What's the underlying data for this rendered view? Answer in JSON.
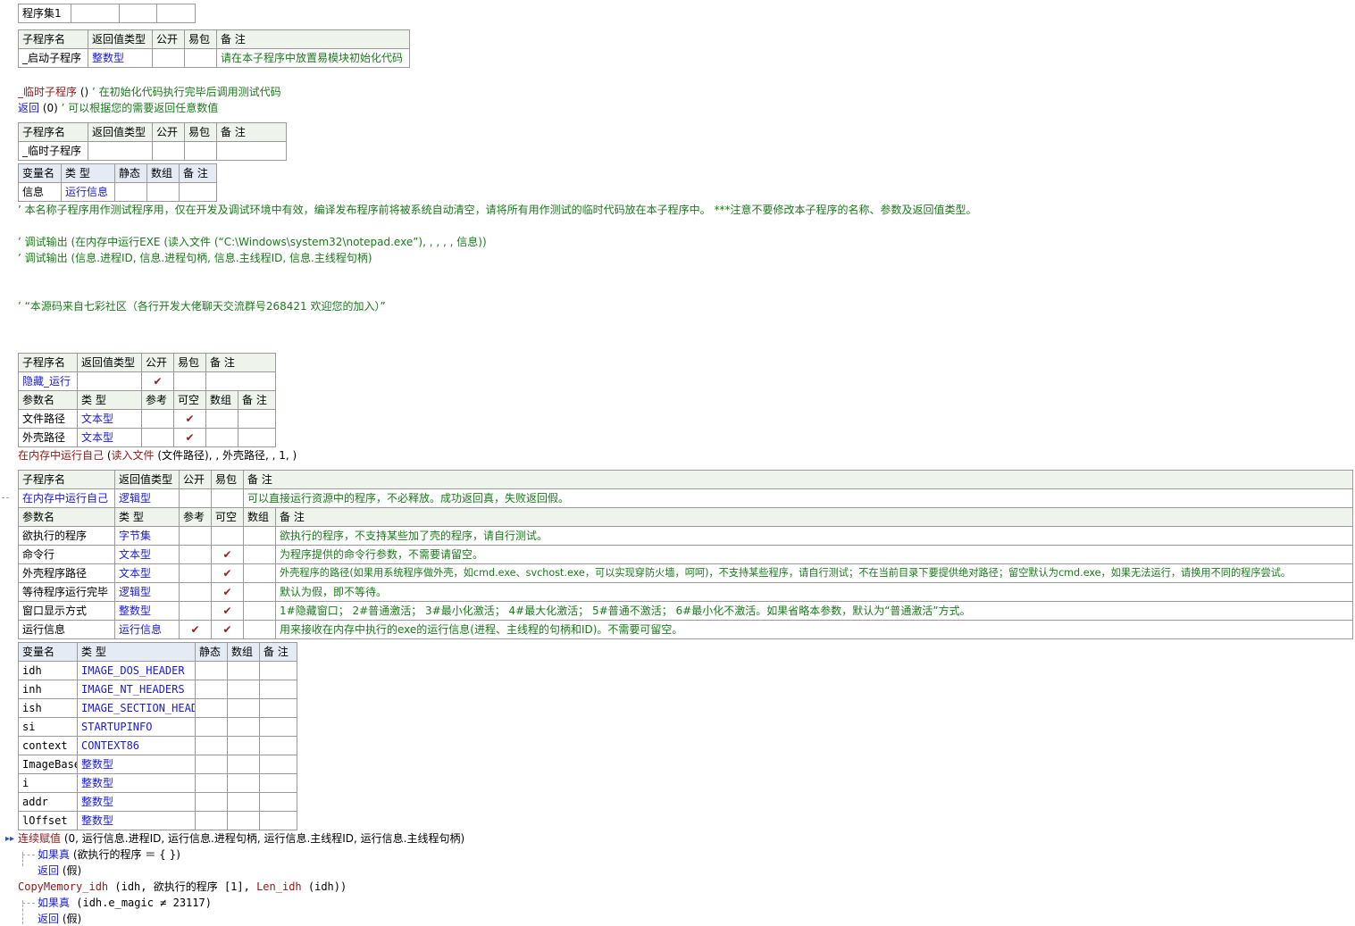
{
  "colors": {
    "keyword_blue": "#1a1ad8",
    "comment_green": "#1a7a1a",
    "call_darkred": "#8b1a1a",
    "check_red": "#9b1c1c",
    "header_bg": "#eef3ec"
  },
  "top_table": {
    "name": "程序集1"
  },
  "start_sub": {
    "headers": [
      "子程序名",
      "返回值类型",
      "公开",
      "易包",
      "备 注"
    ],
    "row": {
      "name": "_启动子程序",
      "type": "整数型",
      "note": "请在本子程序中放置易模块初始化代码"
    }
  },
  "code1": {
    "line1_call": "_临时子程序",
    "line1_args": " ()",
    "line1_comment": "’ 在初始化代码执行完毕后调用测试代码",
    "line2_kw": "返回",
    "line2_args": " (0)",
    "line2_comment": "’ 可以根据您的需要返回任意数值"
  },
  "temp_sub": {
    "headers": [
      "子程序名",
      "返回值类型",
      "公开",
      "易包",
      "备 注"
    ],
    "row": {
      "name": "_临时子程序"
    },
    "var_headers": [
      "变量名",
      "类 型",
      "静态",
      "数组",
      "备 注"
    ],
    "var_row": {
      "name": "信息",
      "type": "运行信息"
    }
  },
  "comments": {
    "c1": "’ 本名称子程序用作测试程序用，仅在开发及调试环境中有效，编译发布程序前将被系统自动清空，请将所有用作测试的临时代码放在本子程序中。 ***注意不要修改本子程序的名称、参数及返回值类型。",
    "c2": "’ 调试输出 (在内存中运行EXE (读入文件 (“C:\\Windows\\system32\\notepad.exe”), , , , , 信息))",
    "c3": "’ 调试输出 (信息.进程ID, 信息.进程句柄, 信息.主线程ID, 信息.主线程句柄)",
    "c4": "’ “本源码来自七彩社区（各行开发大佬聊天交流群号268421 欢迎您的加入）”"
  },
  "hide_sub": {
    "headers": [
      "子程序名",
      "返回值类型",
      "公开",
      "易包",
      "备 注"
    ],
    "row": {
      "name": "隐藏_运行",
      "check": "✔"
    },
    "param_headers": [
      "参数名",
      "类 型",
      "参考",
      "可空",
      "数组",
      "备 注"
    ],
    "params": [
      {
        "name": "文件路径",
        "type": "文本型",
        "check": "✔"
      },
      {
        "name": "外壳路径",
        "type": "文本型",
        "check": "✔"
      }
    ]
  },
  "code2": {
    "call": "在内存中运行自己",
    "mid": " (",
    "call2": "读入文件",
    "rest": " (文件路径), , 外壳路径, , 1, )"
  },
  "mem_sub": {
    "headers": [
      "子程序名",
      "返回值类型",
      "公开",
      "易包",
      "备 注"
    ],
    "row": {
      "name": "在内存中运行自己",
      "type": "逻辑型",
      "note": "可以直接运行资源中的程序，不必释放。成功返回真，失败返回假。"
    },
    "param_headers": [
      "参数名",
      "类 型",
      "参考",
      "可空",
      "数组",
      "备 注"
    ],
    "params": [
      {
        "name": "欲执行的程序",
        "type": "字节集",
        "ref": "",
        "opt": "",
        "note": "欲执行的程序，不支持某些加了壳的程序，请自行测试。"
      },
      {
        "name": "命令行",
        "type": "文本型",
        "ref": "",
        "opt": "✔",
        "note": "为程序提供的命令行参数，不需要请留空。"
      },
      {
        "name": "外壳程序路径",
        "type": "文本型",
        "ref": "",
        "opt": "✔",
        "note": "外壳程序的路径(如果用系统程序做外壳，如cmd.exe、svchost.exe，可以实现穿防火墙，呵呵)，不支持某些程序，请自行测试；不在当前目录下要提供绝对路径；留空默认为cmd.exe，如果无法运行，请换用不同的程序尝试。"
      },
      {
        "name": "等待程序运行完毕",
        "type": "逻辑型",
        "ref": "",
        "opt": "✔",
        "note": "默认为假，即不等待。"
      },
      {
        "name": "窗口显示方式",
        "type": "整数型",
        "ref": "",
        "opt": "✔",
        "note": "1#隐藏窗口； 2#普通激活； 3#最小化激活； 4#最大化激活； 5#普通不激活； 6#最小化不激活。如果省略本参数，默认为“普通激活”方式。"
      },
      {
        "name": "运行信息",
        "type": "运行信息",
        "ref": "✔",
        "opt": "✔",
        "note": "用来接收在内存中执行的exe的运行信息(进程、主线程的句柄和ID)。不需要可留空。"
      }
    ],
    "var_headers": [
      "变量名",
      "类 型",
      "静态",
      "数组",
      "备 注"
    ],
    "vars": [
      {
        "name": "idh",
        "type": "IMAGE_DOS_HEADER"
      },
      {
        "name": "inh",
        "type": "IMAGE_NT_HEADERS"
      },
      {
        "name": "ish",
        "type": "IMAGE_SECTION_HEADER"
      },
      {
        "name": "si",
        "type": "STARTUPINFO"
      },
      {
        "name": "context",
        "type": "CONTEXT86"
      },
      {
        "name": "ImageBase",
        "type": "整数型"
      },
      {
        "name": "i",
        "type": "整数型"
      },
      {
        "name": "addr",
        "type": "整数型"
      },
      {
        "name": "lOffset",
        "type": "整数型"
      }
    ]
  },
  "code3": {
    "l1_kw": "连续赋值",
    "l1_rest": " (0, 运行信息.进程ID, 运行信息.进程句柄, 运行信息.主线程ID, 运行信息.主线程句柄)",
    "l2_kw": "如果真",
    "l2_rest": " (欲执行的程序 ＝ {  })",
    "l3_kw": "返回",
    "l3_rest": " (假)",
    "l4_call": "CopyMemory_idh",
    "l4_mid": " (idh, 欲执行的程序 [1], ",
    "l4_call2": "Len_idh",
    "l4_rest": " (idh))",
    "l5_kw": "如果真",
    "l5_rest": " (idh.e_magic ≠ 23117)",
    "l6_kw": "返回",
    "l6_rest": " (假)"
  }
}
